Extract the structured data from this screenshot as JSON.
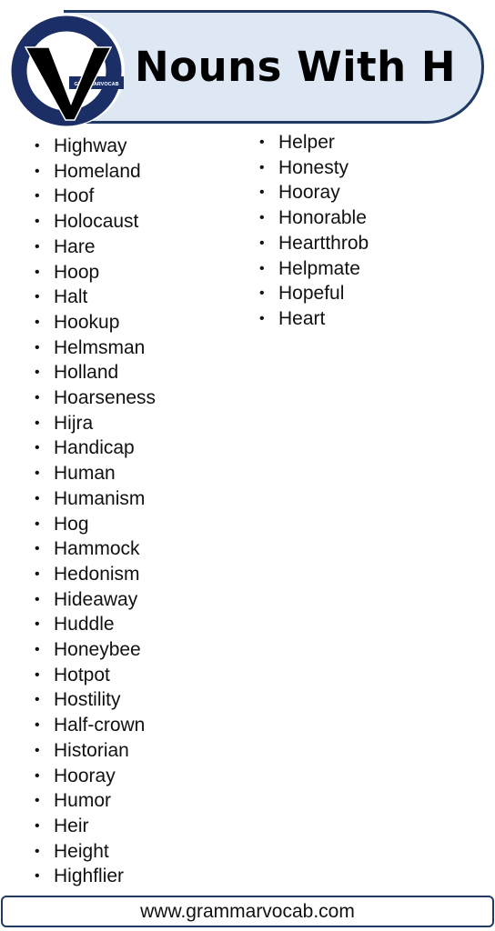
{
  "header": {
    "title": "Nouns With H",
    "logo_text": "GRAMMARVOCAB",
    "colors": {
      "banner_fill": "#dde8f4",
      "banner_border": "#213a64",
      "logo_ring": "#1b2f66"
    }
  },
  "list": {
    "column1": [
      "Highway",
      "Homeland",
      "Hoof",
      "Holocaust",
      "Hare",
      "Hoop",
      "Halt",
      "Hookup",
      "Helmsman",
      "Holland",
      "Hoarseness",
      "Hijra",
      "Handicap",
      "Human",
      "Humanism",
      "Hog",
      "Hammock",
      "Hedonism",
      "Hideaway",
      "Huddle",
      "Honeybee",
      "Hotpot",
      "Hostility",
      "Half-crown",
      "Historian",
      "Hooray",
      "Humor",
      "Heir",
      "Height",
      "Highflier"
    ],
    "column2": [
      "Helper",
      "Honesty",
      "Hooray",
      "Honorable",
      "Heartthrob",
      "Helpmate",
      "Hopeful",
      "Heart"
    ],
    "bullet": "•"
  },
  "footer": {
    "website": "www.grammarvocab.com"
  }
}
